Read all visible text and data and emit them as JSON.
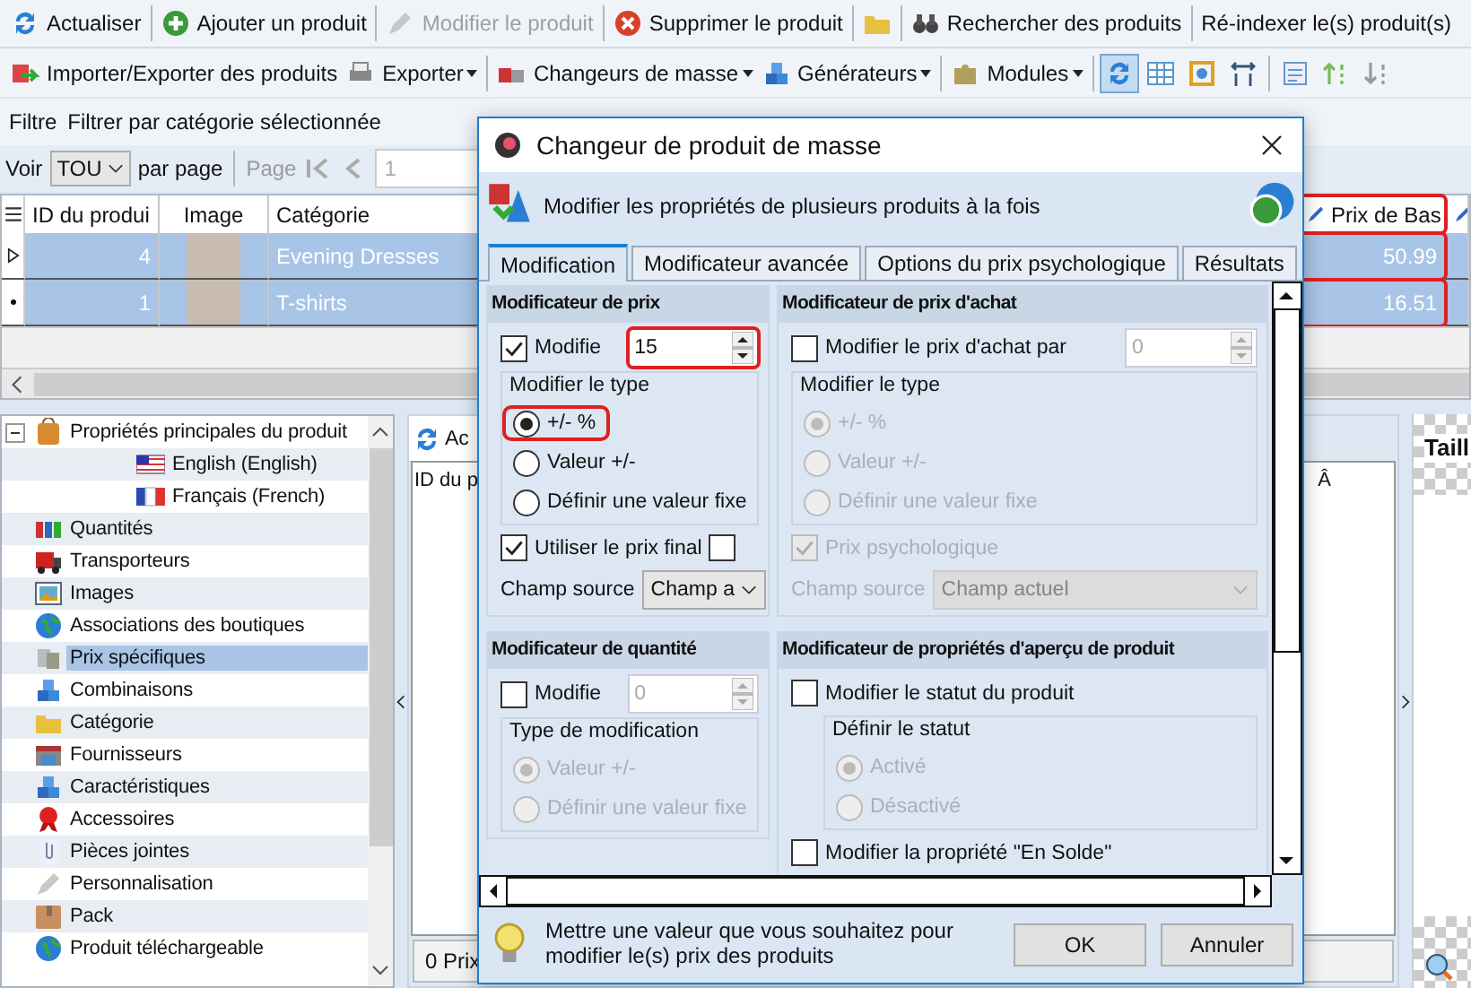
{
  "toolbar": [
    {
      "label": "Actualiser",
      "disabled": false
    },
    {
      "label": "Ajouter un produit",
      "disabled": false
    },
    {
      "label": "Modifier le produit",
      "disabled": true
    },
    {
      "label": "Supprimer le produit",
      "disabled": false
    },
    {
      "disabled": false
    },
    {
      "label": "Rechercher des produits",
      "disabled": false
    },
    {
      "label": "Ré-indexer le(s) produit(s)",
      "disabled": false
    }
  ],
  "toolbar2": {
    "menus": [
      {
        "label": "Importer/Exporter des produits",
        "dropdown": false
      },
      {
        "label": "Exporter",
        "dropdown": true
      },
      {
        "label": "Changeurs de masse",
        "dropdown": true
      },
      {
        "label": "Générateurs",
        "dropdown": true
      },
      {
        "label": "Modules",
        "dropdown": true
      }
    ],
    "toggles": [
      {
        "selected": true
      },
      {
        "selected": false
      },
      {
        "selected": false
      },
      {
        "selected": false
      }
    ]
  },
  "filter": {
    "label": "Filtre",
    "value": "Filtrer par catégorie sélectionnée"
  },
  "pager": {
    "show_label": "Voir",
    "per_page": "TOU",
    "per_page_label": "par page",
    "page_label": "Page",
    "page": "1"
  },
  "grid": {
    "columns": [
      "ID du produi",
      "Image",
      "Catégorie",
      "Prix de Bas"
    ],
    "price_highlighted": true,
    "rows": [
      {
        "id": "4",
        "category": "Evening Dresses",
        "price": "50.99",
        "selected": true,
        "current": true
      },
      {
        "id": "1",
        "category": "T-shirts",
        "price": "16.51",
        "selected": true,
        "current": false
      }
    ]
  },
  "tree": [
    {
      "label": "Propriétés principales du produit",
      "expanded": true,
      "selected": false,
      "children": [
        {
          "label": "English (English)",
          "selected": false
        },
        {
          "label": "Français (French)",
          "selected": false
        }
      ]
    },
    {
      "label": "Quantités",
      "selected": false
    },
    {
      "label": "Transporteurs",
      "selected": false
    },
    {
      "label": "Images",
      "selected": false
    },
    {
      "label": "Associations des boutiques",
      "selected": false
    },
    {
      "label": "Prix spécifiques",
      "selected": true
    },
    {
      "label": "Combinaisons",
      "selected": false
    },
    {
      "label": "Catégorie",
      "selected": false
    },
    {
      "label": "Fournisseurs",
      "selected": false
    },
    {
      "label": "Caractéristiques",
      "selected": false
    },
    {
      "label": "Accessoires",
      "selected": false
    },
    {
      "label": "Pièces jointes",
      "selected": false
    },
    {
      "label": "Personnalisation",
      "selected": false
    },
    {
      "label": "Pack",
      "selected": false
    },
    {
      "label": "Produit téléchargeable",
      "selected": false
    }
  ],
  "panel": {
    "tab": "Ac",
    "column": "ID du p",
    "status": "0 Prix",
    "fragment": "Â"
  },
  "side_panel": {
    "title": "Taill"
  },
  "dialog": {
    "title": "Changeur de produit de masse",
    "header": "Modifier les propriétés de plusieurs produits à la fois",
    "tabs": [
      {
        "label": "Modification",
        "selected": true
      },
      {
        "label": "Modificateur avancée",
        "selected": false
      },
      {
        "label": "Options du prix psychologique",
        "selected": false
      },
      {
        "label": "Résultats",
        "selected": false
      }
    ],
    "price": {
      "title": "Modificateur de prix",
      "checkbox": {
        "label": "Modifie",
        "checked": true
      },
      "value": "15",
      "value_highlighted": true,
      "type_label": "Modifier le type",
      "radios": [
        {
          "label": "+/- %",
          "selected": true,
          "highlighted": true
        },
        {
          "label": "Valeur +/-",
          "selected": false,
          "highlighted": false
        },
        {
          "label": "Définir une valeur fixe",
          "selected": false,
          "highlighted": false
        }
      ],
      "final": {
        "label": "Utiliser le prix final",
        "checked": true
      },
      "extra_checked": false,
      "source_label": "Champ source",
      "source_value": "Champ a"
    },
    "purchase": {
      "title": "Modificateur de prix d'achat",
      "checkbox": {
        "label": "Modifier le prix d'achat par",
        "checked": false
      },
      "value": "0",
      "disabled": true,
      "type_label": "Modifier le type",
      "radios": [
        {
          "label": "+/- %",
          "selected": true
        },
        {
          "label": "Valeur +/-",
          "selected": false
        },
        {
          "label": "Définir une valeur fixe",
          "selected": false
        }
      ],
      "psych": {
        "label": "Prix psychologique",
        "checked": true
      },
      "source_label": "Champ source",
      "source_value": "Champ actuel"
    },
    "quantity": {
      "title": "Modificateur de quantité",
      "checkbox": {
        "label": "Modifie",
        "checked": false
      },
      "value": "0",
      "disabled": true,
      "type_label": "Type de modification",
      "radios": [
        {
          "label": "Valeur +/-",
          "selected": true
        },
        {
          "label": "Définir une valeur fixe",
          "selected": false
        }
      ]
    },
    "preview": {
      "title": "Modificateur de propriétés d'aperçu de produit",
      "checkbox": {
        "label": "Modifier le statut du produit",
        "checked": false
      },
      "status_label": "Définir le statut",
      "disabled": true,
      "radios": [
        {
          "label": "Activé",
          "selected": true
        },
        {
          "label": "Désactivé",
          "selected": false
        }
      ],
      "sale": {
        "label": "Modifier la propriété \"En Solde\"",
        "checked": false
      }
    },
    "hint": "Mettre une valeur que vous souhaitez pour modifier le(s) prix des produits",
    "buttons": [
      "OK",
      "Annuler"
    ]
  }
}
